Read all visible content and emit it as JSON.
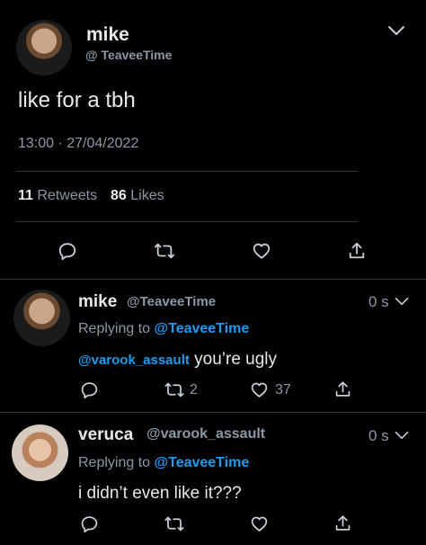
{
  "main_tweet": {
    "display_name": "mike",
    "handle": "@ TeaveeTime",
    "text": "like for a tbh",
    "timestamp": "13:00 · 27/04/2022",
    "retweets_count": "11",
    "retweets_label": "Retweets",
    "likes_count": "86",
    "likes_label": "Likes"
  },
  "replies": [
    {
      "display_name": "mike",
      "handle": "@TeaveeTime",
      "time": "0 s",
      "replying_label": "Replying to",
      "replying_to": "@TeaveeTime",
      "mention": "@varook_assault",
      "text": " you’re ugly",
      "retweet_count": "2",
      "like_count": "37"
    },
    {
      "display_name": "veruca",
      "handle": "@varook_assault",
      "time": "0 s",
      "replying_label": "Replying to",
      "replying_to": "@TeaveeTime",
      "text": "i didn’t even like it???"
    }
  ],
  "icons": {
    "more": "chevron-down-icon",
    "reply": "reply-icon",
    "retweet": "retweet-icon",
    "like": "heart-icon",
    "share": "share-icon"
  }
}
